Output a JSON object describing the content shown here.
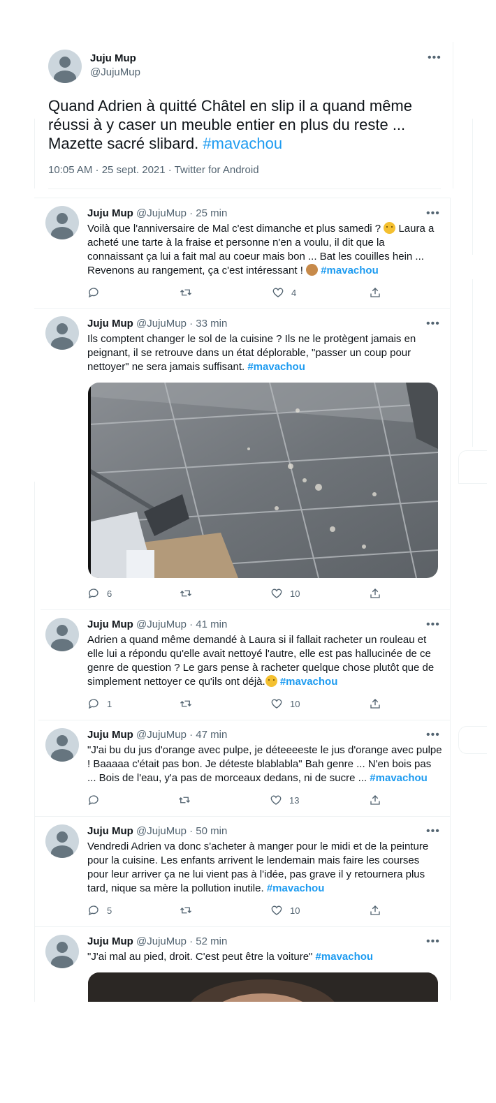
{
  "main_tweet": {
    "name": "Juju Mup",
    "handle": "@JujuMup",
    "text_parts": [
      "Quand Adrien à quitté Châtel en slip il a quand même",
      "réussi à y caser un meuble entier en plus du reste ...",
      "Mazette sacré slibard. "
    ],
    "hashtag": "#mavachou",
    "meta": "10:05 AM · 25 sept. 2021 · Twitter for Android"
  },
  "replies": [
    {
      "name": "Juju Mup",
      "handle": "@JujuMup",
      "time": "· 25 min",
      "lines": [
        "Voilà que l'anniversaire de Mal c'est dimanche et plus samedi ? ",
        "Laura a",
        "acheté une tarte à la fraise et personne n'en a voulu, il dit que la",
        "connaissant ça lui a fait mal au coeur mais bon ... Bat les couilles hein ...",
        "Revenons au rangement, ça c'est intéressant ! "
      ],
      "hashtag": "#mavachou",
      "reply_count": "",
      "like_count": "4"
    },
    {
      "name": "Juju Mup",
      "handle": "@JujuMup",
      "time": "· 33 min",
      "lines": [
        "Ils comptent changer le sol de la cuisine ? Ils ne le protègent jamais en",
        "peignant, il se retrouve dans un état déplorable, \"passer un coup pour",
        "nettoyer\" ne sera jamais suffisant. "
      ],
      "hashtag": "#mavachou",
      "reply_count": "6",
      "like_count": "10"
    },
    {
      "name": "Juju Mup",
      "handle": "@JujuMup",
      "time": "· 41 min",
      "lines": [
        "Adrien a quand même demandé à Laura si il fallait racheter un rouleau et",
        "elle lui a répondu qu'elle avait nettoyé l'autre, elle est pas hallucinée de ce",
        "genre de question ? Le gars pense à racheter quelque chose plutôt que de",
        "simplement nettoyer ce qu'ils ont déjà."
      ],
      "hashtag": "#mavachou",
      "reply_count": "1",
      "like_count": "10"
    },
    {
      "name": "Juju Mup",
      "handle": "@JujuMup",
      "time": "· 47 min",
      "lines": [
        "\"J'ai bu du jus d'orange avec pulpe, je déteeeeste le jus d'orange avec pulpe",
        "! Baaaaa c'était pas bon. Je déteste blablabla\" Bah genre ... N'en bois pas",
        "... Bois de l'eau, y'a pas de morceaux dedans, ni de sucre ... "
      ],
      "hashtag": "#mavachou",
      "reply_count": "",
      "like_count": "13"
    },
    {
      "name": "Juju Mup",
      "handle": "@JujuMup",
      "time": "· 50 min",
      "lines": [
        "Vendredi Adrien va donc s'acheter à manger pour le midi et de la peinture",
        "pour la cuisine. Les enfants arrivent le lendemain mais faire les courses",
        "pour leur arriver ça ne lui vient pas à l'idée, pas grave il y retournera plus",
        "tard, nique sa mère la pollution inutile. "
      ],
      "hashtag": "#mavachou",
      "reply_count": "5",
      "like_count": "10"
    },
    {
      "name": "Juju Mup",
      "handle": "@JujuMup",
      "time": "· 52 min",
      "lines": [
        "\"J'ai mal au pied, droit. C'est peut être la voiture\" "
      ],
      "hashtag": "#mavachou"
    }
  ]
}
